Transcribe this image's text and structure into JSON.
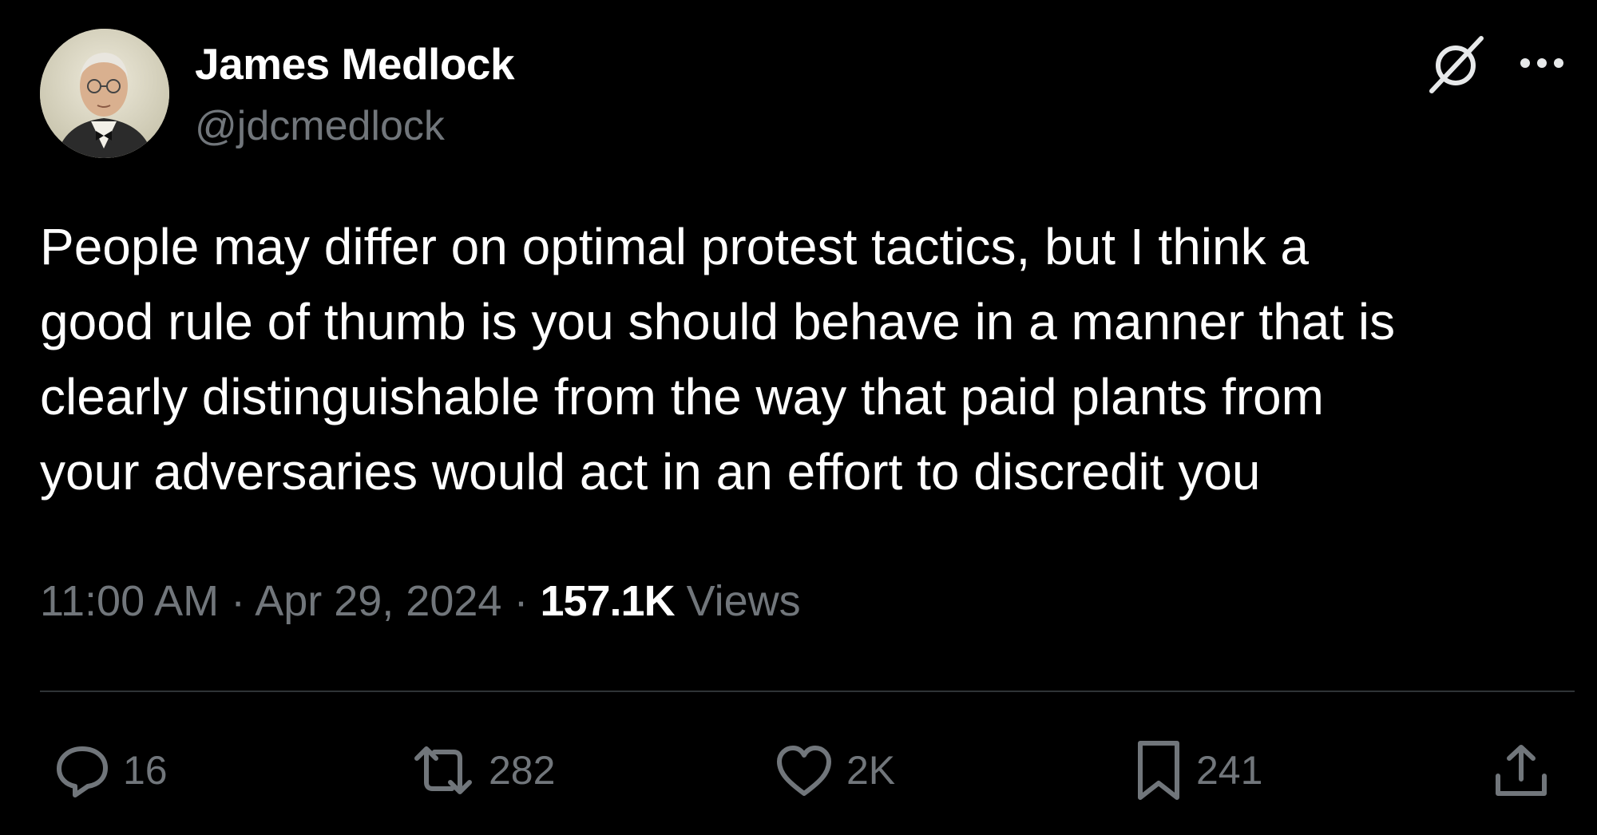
{
  "author": {
    "display_name": "James Medlock",
    "handle": "@jdcmedlock"
  },
  "tweet": {
    "text_lines": [
      "People may differ on optimal protest tactics, but I think a",
      "good rule of thumb is you should behave in a manner that is",
      "clearly distinguishable from the way that paid plants from",
      "your adversaries would act in an effort to discredit you"
    ]
  },
  "meta": {
    "time": "11:00 AM",
    "separator": "·",
    "date": "Apr 29, 2024",
    "views_count": "157.1K",
    "views_label": "Views"
  },
  "actions": {
    "replies": "16",
    "reposts": "282",
    "likes": "2K",
    "bookmarks": "241"
  },
  "icons": {
    "header": [
      "grok-icon",
      "more-icon"
    ],
    "action_bar": [
      "reply-icon",
      "repost-icon",
      "like-icon",
      "bookmark-icon",
      "share-icon"
    ]
  },
  "colors": {
    "background": "#000000",
    "primary_text": "#ffffff",
    "secondary_text": "#71767b",
    "divider": "#2f3336"
  }
}
